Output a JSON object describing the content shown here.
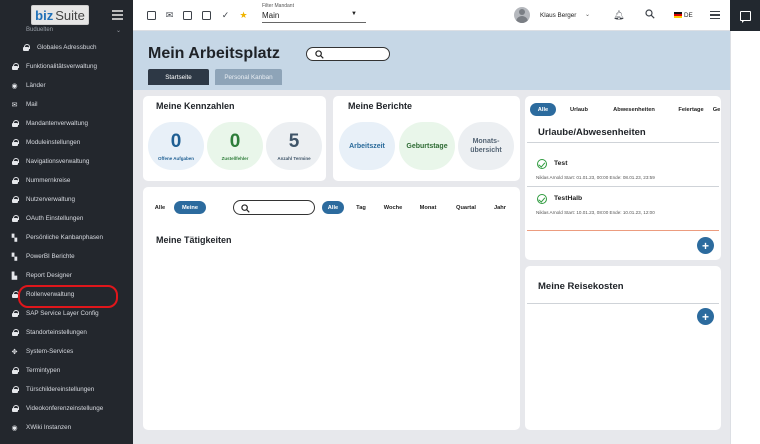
{
  "app": {
    "logo_part1": "biz",
    "logo_part2": "Suite"
  },
  "sidebar": {
    "partial_item": "Buduelten",
    "items": [
      {
        "label": "Globales Adressbuch",
        "icon": "lock-icon",
        "sub": true
      },
      {
        "label": "Funktionalitätsverwaltung",
        "icon": "lock-icon"
      },
      {
        "label": "Länder",
        "icon": "globe-icon"
      },
      {
        "label": "Mail",
        "icon": "mail-icon"
      },
      {
        "label": "Mandantenverwaltung",
        "icon": "lock-icon"
      },
      {
        "label": "Moduleinstellungen",
        "icon": "lock-icon"
      },
      {
        "label": "Navigationsverwaltung",
        "icon": "lock-icon"
      },
      {
        "label": "Nummernkreise",
        "icon": "lock-icon"
      },
      {
        "label": "Nutzerverwaltung",
        "icon": "lock-icon"
      },
      {
        "label": "OAuth Einstellungen",
        "icon": "lock-icon"
      },
      {
        "label": "Persönliche Kanbanphasen",
        "icon": "kanban-icon"
      },
      {
        "label": "PowerBI Berichte",
        "icon": "kanban-icon"
      },
      {
        "label": "Report Designer",
        "icon": "file-icon"
      },
      {
        "label": "Rollenverwaltung",
        "icon": "lock-icon",
        "highlight": true
      },
      {
        "label": "SAP Service Layer Config",
        "icon": "lock-icon"
      },
      {
        "label": "Standorteinstellungen",
        "icon": "lock-icon"
      },
      {
        "label": "System-Services",
        "icon": "move-icon"
      },
      {
        "label": "Termintypen",
        "icon": "lock-icon"
      },
      {
        "label": "Türschildereinstellungen",
        "icon": "lock-icon"
      },
      {
        "label": "Videokonferenzeinstellunge",
        "icon": "lock-icon"
      },
      {
        "label": "XWiki Instanzen",
        "icon": "globe-icon"
      }
    ]
  },
  "topbar": {
    "filter_label": "Filter Mandant",
    "filter_value": "Main",
    "user_name": "Klaus Berger",
    "language": "DE"
  },
  "header": {
    "title": "Mein Arbeitsplatz",
    "tabs": [
      "Startseite",
      "Personal Kanban"
    ]
  },
  "kennzahlen": {
    "title": "Meine Kennzahlen",
    "items": [
      {
        "value": "0",
        "label": "Offene Aufgaben",
        "color": "#1f5f93",
        "bg": "#e8f0f8"
      },
      {
        "value": "0",
        "label": "Zustellfehler",
        "color": "#2e7d3a",
        "bg": "#e9f6ea"
      },
      {
        "value": "5",
        "label": "Anzahl Termine",
        "color": "#3f5468",
        "bg": "#eceff2"
      }
    ]
  },
  "berichte": {
    "title": "Meine Berichte",
    "items": [
      {
        "label": "Arbeitszeit",
        "color": "#2a6a9a",
        "bg": "#e8f0f8"
      },
      {
        "label": "Geburtstage",
        "color": "#2e6b34",
        "bg": "#e9f6ea"
      },
      {
        "label": "Monats-\nübersicht",
        "color": "#556575",
        "bg": "#eceff2"
      }
    ]
  },
  "activities": {
    "filter_owner": [
      "Alle",
      "Meine"
    ],
    "filter_period": [
      "Alle",
      "Tag",
      "Woche",
      "Monat",
      "Quartal",
      "Jahr"
    ],
    "title": "Meine Tätigkeiten"
  },
  "absences": {
    "tabs": [
      "Alle",
      "Urlaub",
      "Abwesenheiten",
      "Feiertage",
      "Ge"
    ],
    "title": "Urlaube/Abwesenheiten",
    "entries": [
      {
        "name": "Test",
        "meta": "Niklas Arnold   Start: 01.01.23, 00:00   Ende: 08.01.23, 23:59"
      },
      {
        "name": "TestHalb",
        "meta": "Niklas Arnold   Start: 10.01.23, 08:00   Ende: 10.01.23, 12:00"
      }
    ]
  },
  "travel": {
    "title": "Meine Reisekosten"
  },
  "colors": {
    "accent": "#2c6b9e",
    "sidebar_bg": "#23272d",
    "header_bg": "#c6d7e6",
    "highlight_ring": "#e0161b"
  }
}
